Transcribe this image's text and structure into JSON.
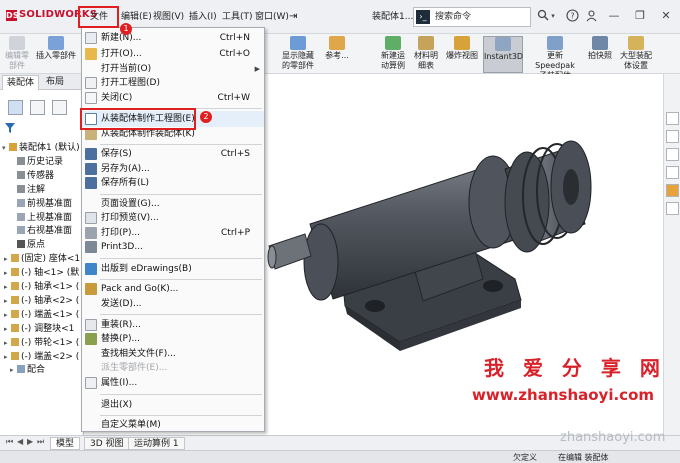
{
  "app": {
    "logo_text": "SOLIDWORKS",
    "logo_mark": "DS"
  },
  "menubar": {
    "file": "文件(F)",
    "edit": "编辑(E)",
    "view": "视图(V)",
    "insert": "插入(I)",
    "tools": "工具(T)",
    "window": "窗口(W)",
    "pin": "⇥"
  },
  "document_title": "装配体1...",
  "search": {
    "placeholder": "搜索命令",
    "prompt_glyph": "›_"
  },
  "ribbon": {
    "edit_part": "编辑零\n部件",
    "insert_parts": "插入零部件",
    "show_hidden": "显示隐藏\n的零部件",
    "reference": "参考...",
    "new_motion": "新建运\n动算例",
    "bom": "材料明\n细表",
    "explode": "爆炸视图",
    "instant3d": "Instant3D",
    "speedpak": "更新 Speedpak\n子装配体",
    "snapshot": "拍快照",
    "large_asm": "大型装配\n体设置"
  },
  "left_tabs": {
    "assembly": "装配体",
    "layout": "布局"
  },
  "tree": {
    "root": "装配体1 (默认)",
    "items": [
      "历史记录",
      "传感器",
      "注解",
      "前视基准面",
      "上视基准面",
      "右视基准面",
      "原点",
      "(固定) 座体<1",
      "(-) 轴<1> (默",
      "(-) 轴承<1> (",
      "(-) 轴承<2> (",
      "(-) 端盖<1> (",
      "(-) 调整块<1",
      "(-) 带轮<1> (",
      "(-) 端盖<2> (",
      "配合"
    ]
  },
  "file_menu": {
    "new": {
      "label": "新建(N)...",
      "shortcut": "Ctrl+N"
    },
    "open": {
      "label": "打开(O)...",
      "shortcut": "Ctrl+O"
    },
    "open_current": {
      "label": "打开当前(O)"
    },
    "open_drawing": {
      "label": "打开工程图(D)"
    },
    "close": {
      "label": "关闭(C)",
      "shortcut": "Ctrl+W"
    },
    "make_drawing": {
      "label": "从装配体制作工程图(E)"
    },
    "make_assembly": {
      "label": "从装配体制作装配体(K)"
    },
    "save": {
      "label": "保存(S)",
      "shortcut": "Ctrl+S"
    },
    "save_as": {
      "label": "另存为(A)..."
    },
    "save_all": {
      "label": "保存所有(L)"
    },
    "page_setup": {
      "label": "页面设置(G)..."
    },
    "print_preview": {
      "label": "打印预览(V)..."
    },
    "print": {
      "label": "打印(P)...",
      "shortcut": "Ctrl+P"
    },
    "print3d": {
      "label": "Print3D..."
    },
    "edrawings": {
      "label": "出版到 eDrawings(B)"
    },
    "pack_go": {
      "label": "Pack and Go(K)..."
    },
    "send": {
      "label": "发送(D)..."
    },
    "reload": {
      "label": "重装(R)..."
    },
    "replace": {
      "label": "替换(P)..."
    },
    "find_refs": {
      "label": "查找相关文件(F)..."
    },
    "derived_part": {
      "label": "派生零部件(E)..."
    },
    "properties": {
      "label": "属性(I)..."
    },
    "exit": {
      "label": "退出(X)"
    },
    "customize": {
      "label": "自定义菜单(M)"
    }
  },
  "annotations": {
    "badge1": "1",
    "badge2": "2"
  },
  "watermark": {
    "line1": "我 爱 分 享 网",
    "line2": "www.zhanshaoyi.com",
    "corner": "zhanshaoyi.com"
  },
  "bottom_tabs": {
    "model": "模型",
    "view3d": "3D 视图",
    "motion": "运动算例 1"
  },
  "status": {
    "underdefined": "欠定义",
    "editing": "在编辑 装配体"
  },
  "colors": {
    "accent_red": "#e02020",
    "brand_red": "#c8102e",
    "watermark_red": "#d9212a",
    "model_metal": "#4a4f57"
  }
}
